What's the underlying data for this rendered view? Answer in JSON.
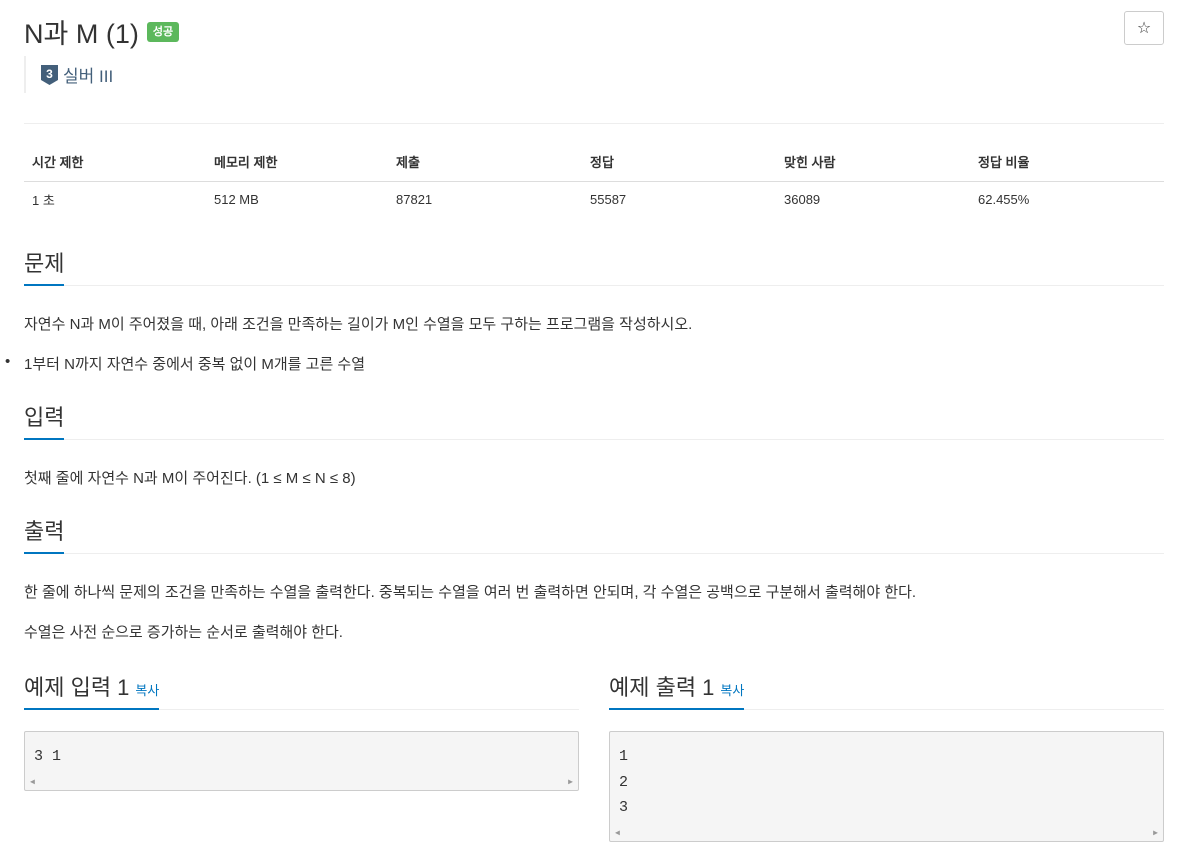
{
  "problem": {
    "title": "N과 M (1)",
    "status_badge": "성공",
    "star_glyph": "☆",
    "tier": {
      "number": "3",
      "label": "실버 III",
      "color": "#435f7a"
    }
  },
  "info_table": {
    "headers": [
      "시간 제한",
      "메모리 제한",
      "제출",
      "정답",
      "맞힌 사람",
      "정답 비율"
    ],
    "values": [
      "1 초",
      "512 MB",
      "87821",
      "55587",
      "36089",
      "62.455%"
    ]
  },
  "sections": {
    "problem": {
      "heading": "문제",
      "description": "자연수 N과 M이 주어졌을 때, 아래 조건을 만족하는 길이가 M인 수열을 모두 구하는 프로그램을 작성하시오.",
      "conditions": [
        "1부터 N까지 자연수 중에서 중복 없이 M개를 고른 수열"
      ]
    },
    "input": {
      "heading": "입력",
      "description": "첫째 줄에 자연수 N과 M이 주어진다. (1 ≤ M ≤ N ≤ 8)"
    },
    "output": {
      "heading": "출력",
      "paragraphs": [
        "한 줄에 하나씩 문제의 조건을 만족하는 수열을 출력한다. 중복되는 수열을 여러 번 출력하면 안되며, 각 수열은 공백으로 구분해서 출력해야 한다.",
        "수열은 사전 순으로 증가하는 순서로 출력해야 한다."
      ]
    }
  },
  "samples": {
    "input": {
      "heading": "예제 입력 1",
      "copy_label": "복사",
      "content": "3 1"
    },
    "output": {
      "heading": "예제 출력 1",
      "copy_label": "복사",
      "content": "1\n2\n3"
    }
  },
  "colors": {
    "accent": "#0076c0",
    "success": "#5cb85c",
    "border": "#eeeeee"
  },
  "icons": {
    "star": "star-icon",
    "tier": "silver-tier-icon"
  }
}
